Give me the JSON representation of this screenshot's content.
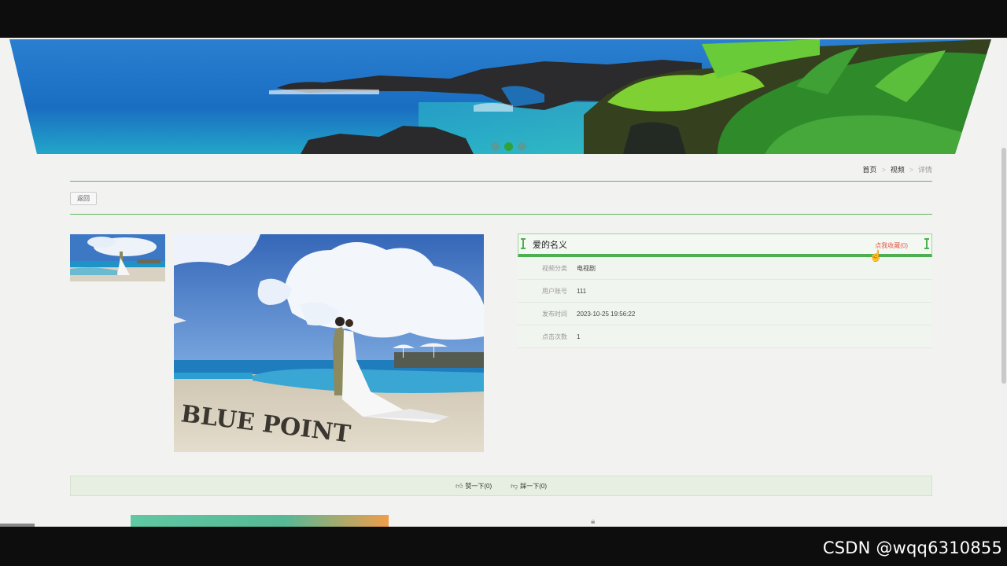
{
  "breadcrumb": {
    "home": "首页",
    "sep1": ">",
    "section": "视频",
    "sep2": ">",
    "current": "详情"
  },
  "back_button": "返回",
  "detail": {
    "title": "爱的名义",
    "collect_label": "点我收藏(0)",
    "rows": [
      {
        "label": "视频分类",
        "value": "电视剧"
      },
      {
        "label": "用户账号",
        "value": "111"
      },
      {
        "label": "发布时间",
        "value": "2023-10-25 19:56:22"
      },
      {
        "label": "点击次数",
        "value": "1"
      }
    ]
  },
  "like_bar": {
    "like": "赞一下(0)",
    "dislike": "踩一下(0)"
  },
  "photo_sign": "BLUE POINT",
  "carousel": {
    "slides": 3,
    "active_index": 1
  },
  "watermark": "CSDN @wqq6310855",
  "colors": {
    "accent_green": "#4caf50",
    "collect_red": "#e15b4b",
    "page_bg": "#f2f3f1"
  },
  "icons": {
    "like": "thumbs-up-icon",
    "dislike": "thumbs-down-icon",
    "cursor": "hand-pointer-icon",
    "lock": "lock-icon"
  }
}
